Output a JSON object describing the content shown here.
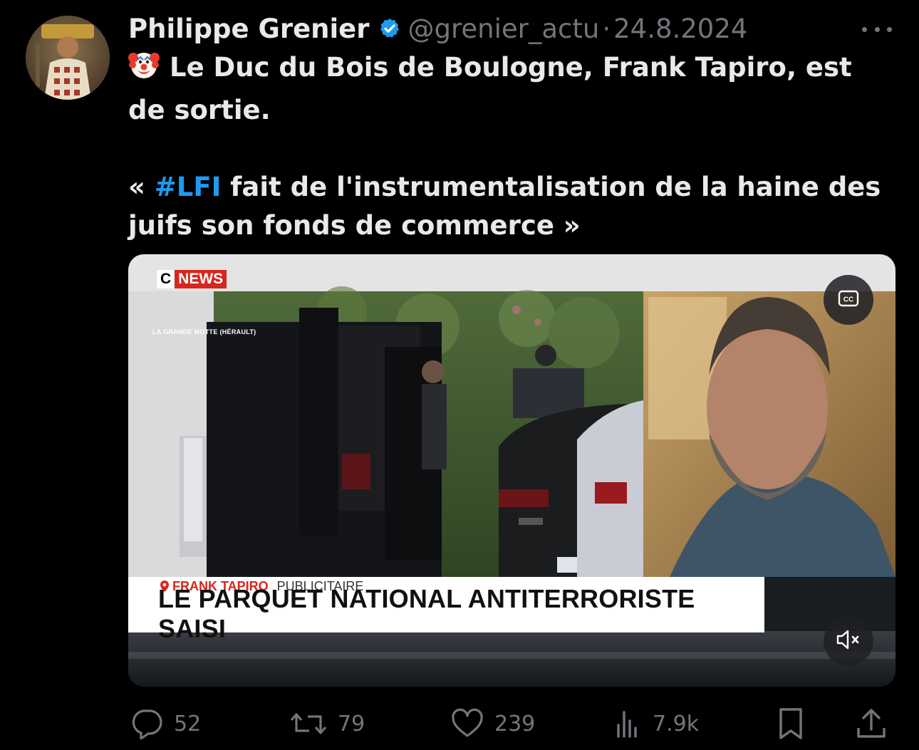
{
  "tweet": {
    "author_name": "Philippe Grenier",
    "handle": "@grenier_actu",
    "separator": "·",
    "date": "24.8.2024",
    "verified": true,
    "text_line1_emoji": "clown-face-emoji",
    "text_line1": "Le Duc du Bois de Boulogne, Frank Tapiro, est de sortie.",
    "quote_open": "« ",
    "hashtag": "#LFI",
    "quote_rest": " fait de l'instrumentalisation de la haine des juifs son fonds de commerce »"
  },
  "media": {
    "channel_logo_c": "C",
    "channel_logo_news": "NEWS",
    "location": "LA GRANDE MOTTE (HÉRAULT)",
    "guest_name": "FRANK TAPIRO",
    "guest_role": "PUBLICITAIRE",
    "headline": "LE PARQUET NATIONAL ANTITERRORISTE SAISI",
    "cc_icon": "closed-captions-icon",
    "mute_icon": "speaker-muted-icon"
  },
  "actions": {
    "replies": "52",
    "reposts": "79",
    "likes": "239",
    "views": "7.9k"
  },
  "colors": {
    "background": "#000000",
    "text": "#e7e9ea",
    "muted": "#71767b",
    "accent": "#1d9bf0",
    "cnews_red": "#d9261c"
  }
}
